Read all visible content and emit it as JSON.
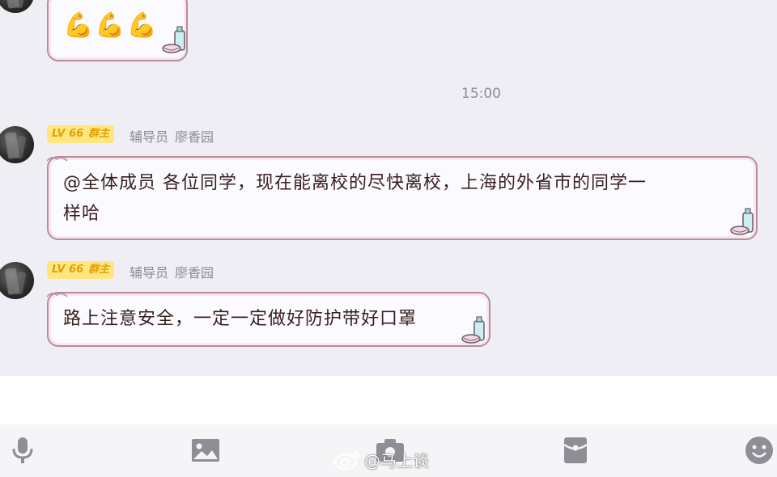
{
  "chat": {
    "emoji_message": {
      "content": "💪💪💪",
      "icon": "flexed-biceps-icon"
    },
    "timestamp": "15:00",
    "messages": [
      {
        "badge_level": "LV 66",
        "badge_role": "群主",
        "sender_title": "辅导员",
        "sender_name": "廖香园",
        "line1": "@全体成员 各位同学，现在能离校的尽快离校，上海的外省市的同学一",
        "line2": "样哈"
      },
      {
        "badge_level": "LV 66",
        "badge_role": "群主",
        "sender_title": "辅导员",
        "sender_name": "廖香园",
        "line1": "路上注意安全，一定一定做好防护带好口罩"
      }
    ]
  },
  "toolbar": {
    "icons": [
      "microphone-icon",
      "image-icon",
      "camera-icon",
      "red-packet-icon",
      "emoji-icon"
    ]
  },
  "watermark": {
    "text": "@马上谈",
    "icon": "weibo-icon"
  },
  "colors": {
    "bubble_border": "#b98c98",
    "badge_bg": "#ffe680",
    "badge_text": "#e2a100",
    "toolbar_icon": "#8e8e96"
  }
}
